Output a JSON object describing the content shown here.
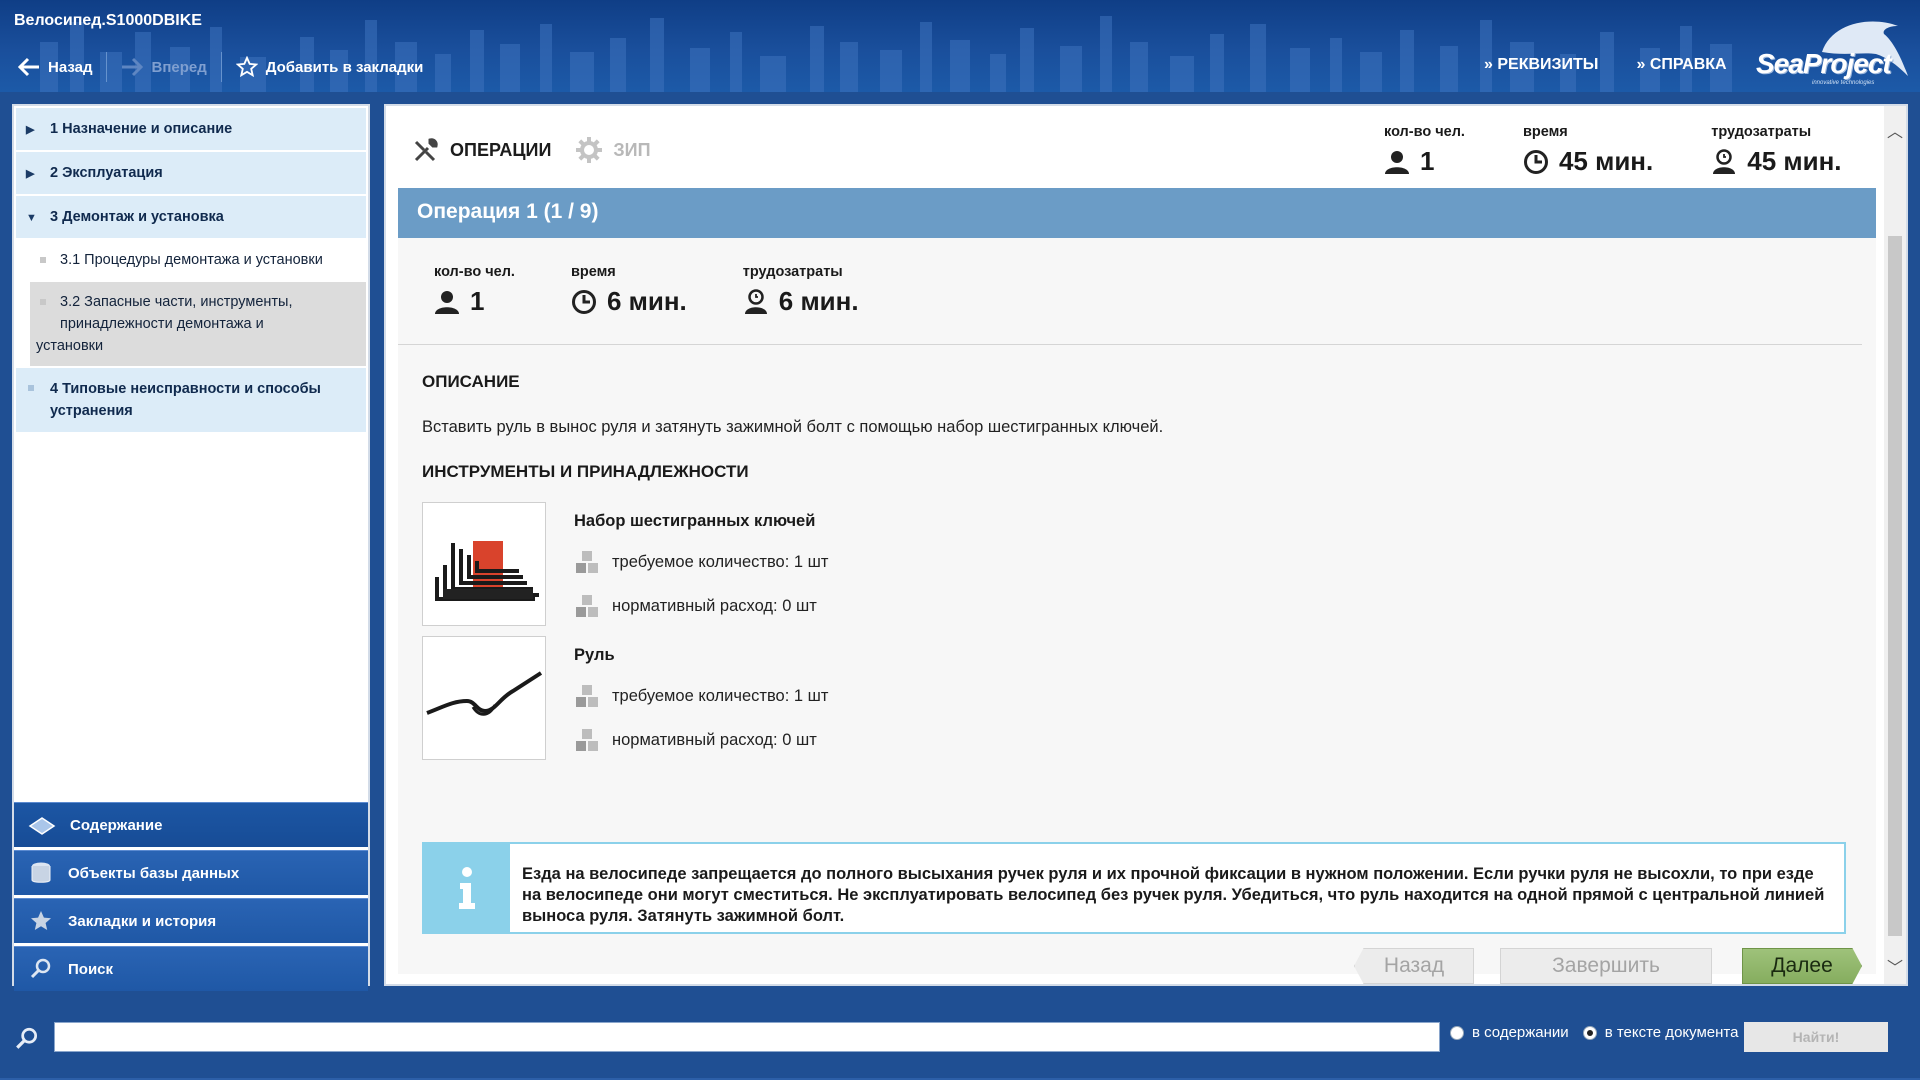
{
  "app": {
    "title": "Велосипед.S1000DBIKE"
  },
  "toolbar": {
    "back": "Назад",
    "forward": "Вперед",
    "bookmark": "Добавить в закладки"
  },
  "header_links": {
    "details": "» РЕКВИЗИТЫ",
    "help": "» СПРАВКА"
  },
  "logo": {
    "text": "SeaProject",
    "sub": "innovative technologies"
  },
  "toc": {
    "items": [
      {
        "label": "1 Назначение и описание"
      },
      {
        "label": "2 Эксплуатация"
      },
      {
        "label": "3 Демонтаж и установка"
      },
      {
        "label": "4 Типовые неисправности и способы устранения"
      }
    ],
    "sub_items": [
      {
        "label": "3.1 Процедуры демонтажа и установки"
      },
      {
        "label_line1": "3.2 Запасные части, инструменты,",
        "label_line2": "принадлежности демонтажа и",
        "label_line3": "установки"
      }
    ]
  },
  "nav": {
    "contents": "Содержание",
    "db_objects": "Объекты базы данных",
    "bookmarks": "Закладки и история",
    "search": "Поиск"
  },
  "tabs": {
    "operations": "ОПЕРАЦИИ",
    "zip": "ЗИП"
  },
  "totals": {
    "people_label": "кол-во чел.",
    "people_value": "1",
    "time_label": "время",
    "time_value": "45 мин.",
    "labor_label": "трудозатраты",
    "labor_value": "45 мин."
  },
  "operation": {
    "title": "Операция 1 (1 / 9)",
    "people_label": "кол-во чел.",
    "people_value": "1",
    "time_label": "время",
    "time_value": "6 мин.",
    "labor_label": "трудозатраты",
    "labor_value": "6 мин.",
    "description_title": "ОПИСАНИЕ",
    "description": "Вставить руль в вынос руля и затянуть зажимной болт с помощью набор шестигранных ключей.",
    "tools_title": "ИНСТРУМЕНТЫ И ПРИНАДЛЕЖНОСТИ",
    "tools": [
      {
        "name": "Набор шестигранных ключей",
        "required": "требуемое количество: 1 шт",
        "norm": "нормативный расход: 0 шт"
      },
      {
        "name": "Руль",
        "required": "требуемое количество: 1 шт",
        "norm": "нормативный расход: 0 шт"
      }
    ],
    "info": "Езда на велосипеде запрещается до полного высыхания ручек руля и их прочной фиксации в нужном положении. Если ручки руля не высохли, то при езде на велосипеде они могут сместиться. Не эксплуатировать велосипед без ручек руля. Убедиться, что руль находится на одной прямой с центральной линией выноса руля. Затянуть зажимной болт."
  },
  "buttons": {
    "back": "Назад",
    "finish": "Завершить",
    "next": "Далее"
  },
  "search": {
    "value": "",
    "in_contents": "в содержании",
    "in_text": "в тексте документа",
    "find": "Найти!"
  }
}
